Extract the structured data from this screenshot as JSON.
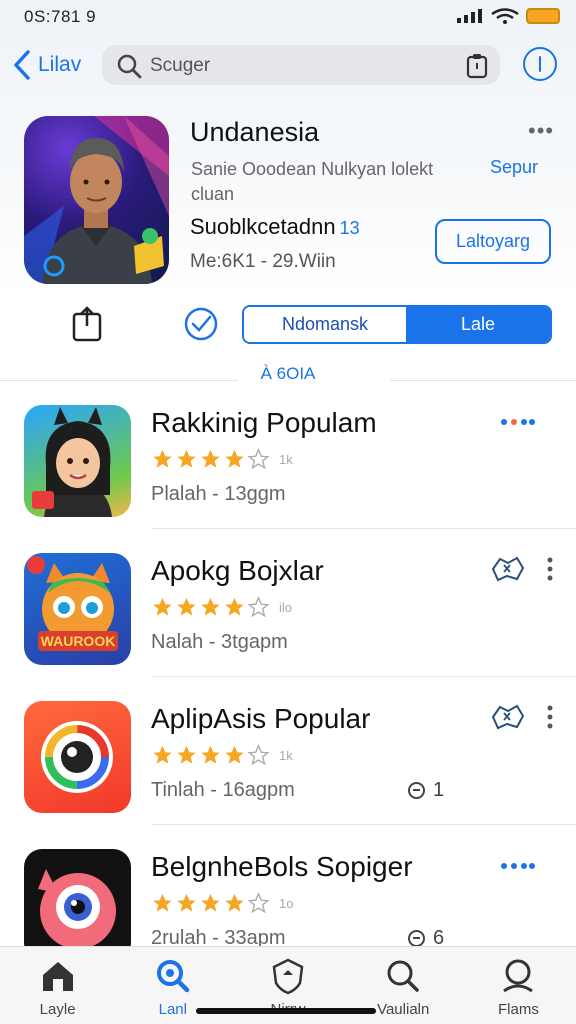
{
  "status": {
    "time": "0S:781 9"
  },
  "nav": {
    "back_label": "Lilav",
    "search_placeholder": "Scuger"
  },
  "featured": {
    "title": "Undanesia",
    "meta": "Sanie Ooodean   Nulkyan   lolekt cluan",
    "link": "Sepur",
    "subtitle": "Suoblkcetadnn",
    "subtitle_badge": "13",
    "size": "Me:6K1 - 29.Wiin",
    "get_label": "Laltoyarg"
  },
  "segment": {
    "left_label": "Ndomansk",
    "right_label": "Lale"
  },
  "section_label": "À 6OIA",
  "apps": [
    {
      "name": "Rakkinig Populam",
      "rating": 4,
      "count": "1k",
      "sub": "Plalah - 13ggm",
      "action": "dots-h",
      "indicator": ""
    },
    {
      "name": "Apokg Bojxlar",
      "rating": 4,
      "count": "ilo",
      "sub": "Nalah - 3tgapm",
      "action": "puzzle",
      "indicator": ""
    },
    {
      "name": "AplipAsis Popular",
      "rating": 4,
      "count": "1k",
      "sub": "Tinlah - 16agpm",
      "action": "puzzle",
      "indicator": "1"
    },
    {
      "name": "BelgnheBols Sopiger",
      "rating": 4,
      "count": "1o",
      "sub": "2rulah - 33apm",
      "action": "dots-h",
      "indicator": "6"
    }
  ],
  "tabs": [
    {
      "label": "Layle",
      "icon": "home-icon",
      "active": false
    },
    {
      "label": "Lanl",
      "icon": "search-today-icon",
      "active": true
    },
    {
      "label": "Nirrw",
      "icon": "shield-icon",
      "active": false
    },
    {
      "label": "Vaulialn",
      "icon": "search-icon",
      "active": false
    },
    {
      "label": "Flams",
      "icon": "profile-search-icon",
      "active": false
    }
  ],
  "colors": {
    "accent": "#1a73e8",
    "star": "#f5a623",
    "battery": "#f5a623"
  }
}
